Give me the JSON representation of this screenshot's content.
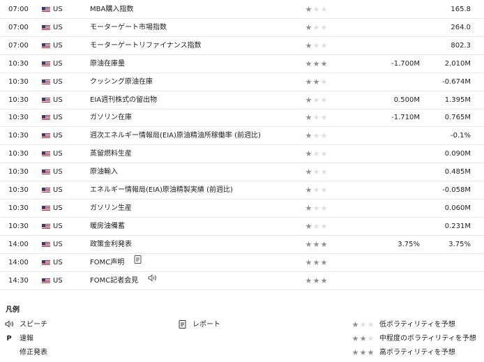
{
  "events": [
    {
      "time": "07:00",
      "country": "US",
      "event": "MBA購入指数",
      "icon": null,
      "stars": 1,
      "forecast": "",
      "actual": "165.8"
    },
    {
      "time": "07:00",
      "country": "US",
      "event": "モーターゲート市場指数",
      "icon": null,
      "stars": 1,
      "forecast": "",
      "actual": "264.0"
    },
    {
      "time": "07:00",
      "country": "US",
      "event": "モーターゲートリファイナンス指数",
      "icon": null,
      "stars": 1,
      "forecast": "",
      "actual": "802.3"
    },
    {
      "time": "10:30",
      "country": "US",
      "event": "原油在庫量",
      "icon": null,
      "stars": 3,
      "forecast": "-1.700M",
      "actual": "2.010M"
    },
    {
      "time": "10:30",
      "country": "US",
      "event": "クッシング原油在庫",
      "icon": null,
      "stars": 2,
      "forecast": "",
      "actual": "-0.674M"
    },
    {
      "time": "10:30",
      "country": "US",
      "event": "EIA週刊株式の留出物",
      "icon": null,
      "stars": 1,
      "forecast": "0.500M",
      "actual": "1.395M"
    },
    {
      "time": "10:30",
      "country": "US",
      "event": "ガソリン在庫",
      "icon": null,
      "stars": 1,
      "forecast": "-1.710M",
      "actual": "0.765M"
    },
    {
      "time": "10:30",
      "country": "US",
      "event": "週次エネルギー情報局(EIA)原油精油所稼働率 (前週比)",
      "icon": null,
      "stars": 1,
      "forecast": "",
      "actual": "-0.1%"
    },
    {
      "time": "10:30",
      "country": "US",
      "event": "蒸留燃料生産",
      "icon": null,
      "stars": 1,
      "forecast": "",
      "actual": "0.090M"
    },
    {
      "time": "10:30",
      "country": "US",
      "event": "原油輸入",
      "icon": null,
      "stars": 1,
      "forecast": "",
      "actual": "0.485M"
    },
    {
      "time": "10:30",
      "country": "US",
      "event": "エネルギー情報局(EIA)原油精製実績 (前週比)",
      "icon": null,
      "stars": 1,
      "forecast": "",
      "actual": "-0.058M"
    },
    {
      "time": "10:30",
      "country": "US",
      "event": "ガソリン生産",
      "icon": null,
      "stars": 1,
      "forecast": "",
      "actual": "0.060M"
    },
    {
      "time": "10:30",
      "country": "US",
      "event": "暖房油備蓄",
      "icon": null,
      "stars": 1,
      "forecast": "",
      "actual": "0.231M"
    },
    {
      "time": "14:00",
      "country": "US",
      "event": "政策金利発表",
      "icon": null,
      "stars": 3,
      "forecast": "3.75%",
      "actual": "3.75%"
    },
    {
      "time": "14:00",
      "country": "US",
      "event": "FOMC声明",
      "icon": "report-icon",
      "stars": 3,
      "forecast": "",
      "actual": ""
    },
    {
      "time": "14:30",
      "country": "US",
      "event": "FOMC記者会見",
      "icon": "speech-icon",
      "stars": 3,
      "forecast": "",
      "actual": ""
    }
  ],
  "legend": {
    "title": "凡例",
    "speech": "スピーチ",
    "report": "レポート",
    "preliminary": "速報",
    "preliminary_badge": "P",
    "revised": "修正発表",
    "low": "低ボラティリティを予想",
    "medium": "中程度のボラティリティを予想",
    "high": "高ボラティリティを予想"
  },
  "colors": {
    "star_on": "#8e8e8e",
    "star_off": "#dedede",
    "divider": "#e7e7e7"
  }
}
